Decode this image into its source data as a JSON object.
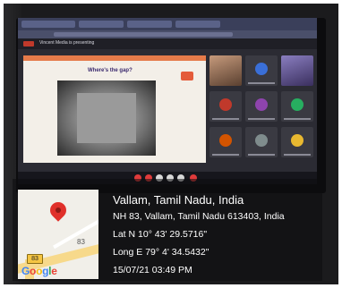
{
  "map": {
    "route_number": "83",
    "road_label": "83",
    "logo_text": "Google",
    "logo_colors": [
      "#4285F4",
      "#EA4335",
      "#FBBC05",
      "#4285F4",
      "#34A853",
      "#EA4335"
    ],
    "pin_color": "#e0302a"
  },
  "info": {
    "place": "Vallam, Tamil Nadu, India",
    "address": "NH 83, Vallam, Tamil Nadu 613403, India",
    "lat": "Lat N 10° 43' 29.5716\"",
    "long": "Long E 79° 4' 34.5432\"",
    "datetime": "15/07/21 03:49 PM"
  },
  "screen": {
    "presenting_text": "Vincent Media is presenting",
    "slide_title": "Where's the gap?",
    "accent": "#e57b4a"
  }
}
